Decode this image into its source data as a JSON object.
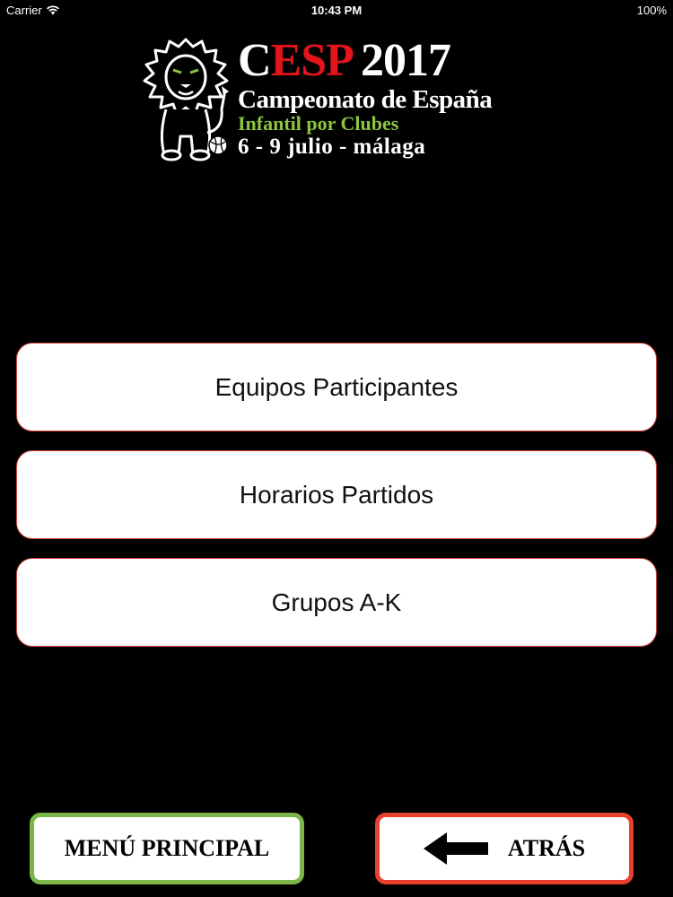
{
  "status_bar": {
    "carrier": "Carrier",
    "time": "10:43 PM",
    "battery": "100%"
  },
  "logo": {
    "c": "C",
    "esp": "ESP",
    "year": "2017",
    "subtitle": "Campeonato de España",
    "category": "Infantil por Clubes",
    "dates": "6 - 9 julio - málaga"
  },
  "menu": {
    "items": [
      {
        "label": "Equipos Participantes"
      },
      {
        "label": "Horarios Partidos"
      },
      {
        "label": "Grupos A-K"
      }
    ]
  },
  "bottom": {
    "menu_principal": "MENÚ PRINCIPAL",
    "atras": "ATRÁS"
  },
  "colors": {
    "background": "#000000",
    "accent_red": "#e3141b",
    "accent_green": "#8cc63f",
    "menu_principal_border": "#7ab648",
    "atras_border": "#e8412f"
  },
  "icons": {
    "logo": "lion-mascot-icon",
    "wifi": "wifi-icon",
    "back": "left-arrow-icon"
  }
}
